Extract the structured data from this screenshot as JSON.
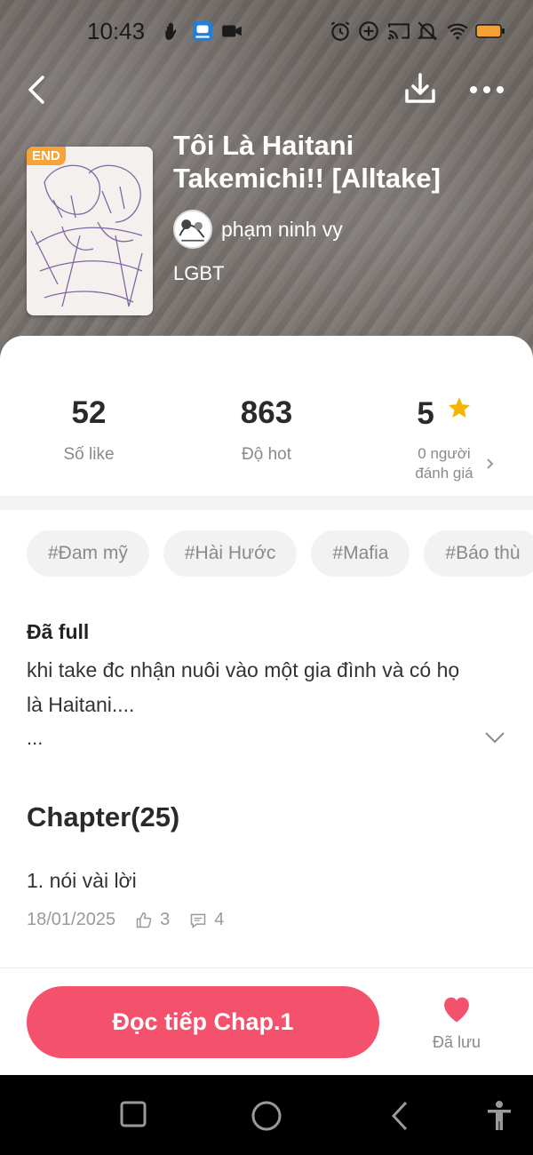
{
  "status_bar": {
    "time": "10:43",
    "icons": [
      "hand-icon",
      "app-badge-icon",
      "video-icon",
      "alarm-icon",
      "plus-circle-icon",
      "cast-icon",
      "bell-off-icon",
      "wifi-icon",
      "battery-icon"
    ]
  },
  "header": {
    "back_icon": "chevron-left-icon",
    "download_icon": "download-icon",
    "more_icon": "more-horizontal-icon"
  },
  "book": {
    "badge": "END",
    "title": "Tôi Là Haitani Takemichi!! [Alltake]",
    "author": "phạm ninh vy",
    "category": "LGBT"
  },
  "stats": {
    "likes_value": "52",
    "likes_label": "Số like",
    "hot_value": "863",
    "hot_label": "Độ hot",
    "rating_value": "5",
    "rating_label_line1": "0 người",
    "rating_label_line2": "đánh giá"
  },
  "tags": [
    "#Đam mỹ",
    "#Hài Hước",
    "#Mafia",
    "#Báo thù"
  ],
  "description": {
    "title": "Đã full",
    "text": "khi take đc nhận nuôi vào một gia đình và có họ là Haitani....",
    "more": "..."
  },
  "chapters": {
    "heading": "Chapter(25)",
    "first": {
      "title": "1. nói vài lời",
      "date": "18/01/2025",
      "likes": "3",
      "comments": "4"
    }
  },
  "actions": {
    "read_button": "Đọc tiếp Chap.1",
    "saved_label": "Đã lưu"
  },
  "colors": {
    "accent": "#f4516c",
    "badge": "#f6a33a",
    "star": "#f5b400"
  }
}
